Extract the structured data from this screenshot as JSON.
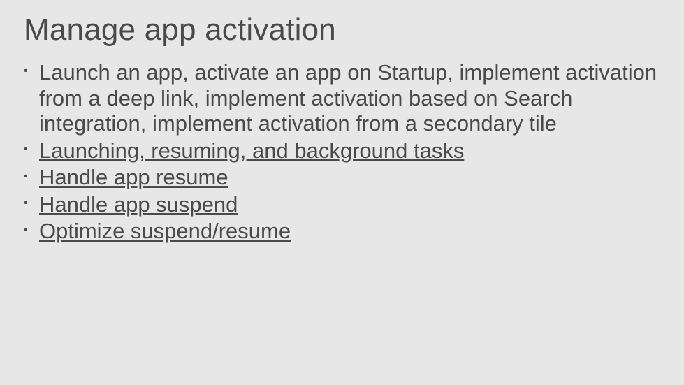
{
  "title": "Manage app activation",
  "bullets": [
    {
      "text": "Launch an app, activate an app on Startup, implement activation from a deep link, implement activation based on Search integration, implement activation from a secondary tile",
      "link": false
    },
    {
      "text": "Launching, resuming, and background tasks",
      "link": true
    },
    {
      "text": "Handle app resume",
      "link": true
    },
    {
      "text": "Handle app suspend",
      "link": true
    },
    {
      "text": "Optimize suspend/resume",
      "link": true
    }
  ]
}
